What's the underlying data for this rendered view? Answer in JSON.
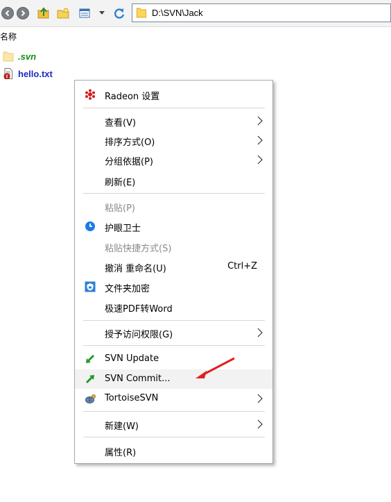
{
  "toolbar": {
    "address_path": "D:\\SVN\\Jack",
    "icons": [
      "back-icon",
      "forward-icon",
      "up-folder-icon",
      "new-folder-icon",
      "view-icon",
      "view-dropdown-icon",
      "refresh-icon",
      "folder-icon"
    ]
  },
  "file_list": {
    "column_name": "名称",
    "items": [
      {
        "name": ".svn",
        "icon": "folder-icon",
        "color": "#148c14"
      },
      {
        "name": "hello.txt",
        "icon": "svn-modified-file-icon",
        "color": "#1d2bc7"
      }
    ]
  },
  "menu": {
    "radeon": "Radeon 设置",
    "view": "查看(V)",
    "sort": "排序方式(O)",
    "group": "分组依据(P)",
    "refresh": "刷新(E)",
    "paste": "粘贴(P)",
    "eye_guard": "护眼卫士",
    "paste_shortcut": "粘贴快捷方式(S)",
    "undo_rename": "撤消 重命名(U)",
    "undo_shortcut": "Ctrl+Z",
    "folder_encrypt": "文件夹加密",
    "pdf_to_word": "极速PDF转Word",
    "grant_access": "授予访问权限(G)",
    "svn_update": "SVN Update",
    "svn_commit": "SVN Commit...",
    "tortoise": "TortoiseSVN",
    "new": "新建(W)",
    "properties": "属性(R)"
  },
  "colors": {
    "svn_folder_name": "#148c14",
    "modified_file_name": "#1d2bc7",
    "annotation_arrow": "#e02020",
    "hover_row": "#f2f2f2"
  }
}
